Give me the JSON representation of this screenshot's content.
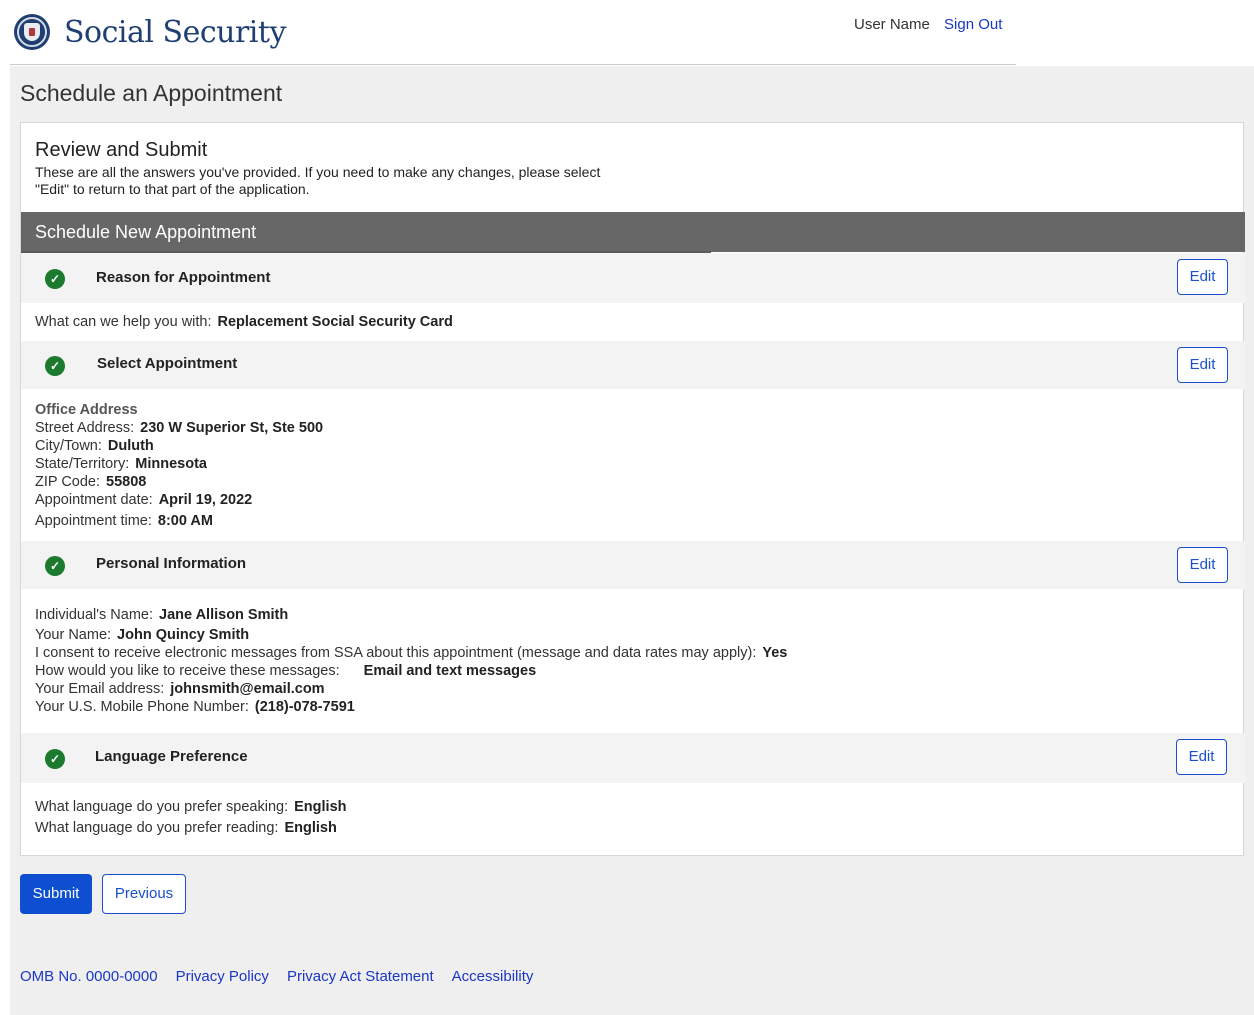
{
  "header": {
    "site_title": "Social Security",
    "user_name": "User Name",
    "sign_out": "Sign Out"
  },
  "page_title": "Schedule an Appointment",
  "intro": {
    "title": "Review and Submit",
    "text_line1": "These are all the answers you've provided. If you need to make any changes, please select",
    "text_line2": "\"Edit\" to return to that part of the application."
  },
  "section_title": "Schedule New Appointment",
  "edit_label": "Edit",
  "reason": {
    "title": "Reason for Appointment",
    "label": "What can we help you with:",
    "value": "Replacement Social Security Card"
  },
  "appointment": {
    "title": "Select Appointment",
    "office_heading": "Office Address",
    "street_label": "Street Address:",
    "street_value": "230 W Superior St, Ste 500",
    "city_label": "City/Town:",
    "city_value": "Duluth",
    "state_label": "State/Territory:",
    "state_value": "Minnesota",
    "zip_label": "ZIP Code:",
    "zip_value": "55808",
    "date_label": "Appointment date:",
    "date_value": "April 19, 2022",
    "time_label": "Appointment time:",
    "time_value": "8:00 AM"
  },
  "personal": {
    "title": "Personal Information",
    "individual_label": "Individual's Name:",
    "individual_value": "Jane Allison Smith",
    "your_name_label": "Your Name:",
    "your_name_value": "John Quincy Smith",
    "consent_label": "I consent to receive electronic messages from SSA about this appointment (message and data rates may apply):",
    "consent_value": "Yes",
    "method_label": "How would you like to receive these messages:",
    "method_value": "Email and text messages",
    "email_label": "Your Email address:",
    "email_value": "johnsmith@email.com",
    "phone_label": "Your U.S. Mobile Phone Number:",
    "phone_value": "(218)-078-7591"
  },
  "language": {
    "title": "Language Preference",
    "speaking_label": "What language do you prefer speaking:",
    "speaking_value": "English",
    "reading_label": "What language do you prefer reading:",
    "reading_value": "English"
  },
  "buttons": {
    "submit": "Submit",
    "previous": "Previous"
  },
  "footer": {
    "omb": "OMB No. 0000-0000",
    "privacy_policy": "Privacy Policy",
    "privacy_act": "Privacy Act Statement",
    "accessibility": "Accessibility"
  },
  "colors": {
    "brand_blue": "#1f3f73",
    "link_blue": "#1a37c5",
    "button_blue": "#0d4fd0",
    "check_green": "#1b7a2e",
    "section_bar": "#676767"
  }
}
